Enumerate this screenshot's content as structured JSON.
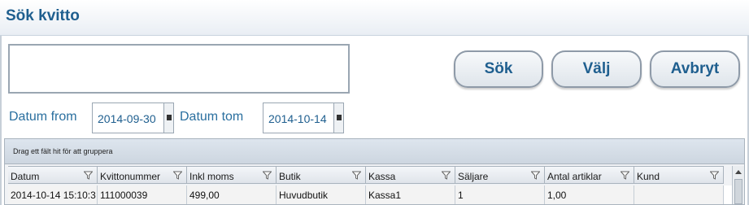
{
  "window": {
    "title": "Sök kvitto"
  },
  "buttons": {
    "search": "Sök",
    "select": "Välj",
    "cancel": "Avbryt"
  },
  "search": {
    "value": ""
  },
  "date_from": {
    "label": "Datum from",
    "value": "2014-09-30"
  },
  "date_to": {
    "label": "Datum tom",
    "value": "2014-10-14"
  },
  "grid": {
    "group_hint": "Drag ett fält hit för att gruppera",
    "columns": [
      "Datum",
      "Kvittonummer",
      "Inkl moms",
      "Butik",
      "Kassa",
      "Säljare",
      "Antal artiklar",
      "Kund"
    ],
    "rows": [
      [
        "2014-10-14 15:10:3",
        "111000039",
        "499,00",
        "Huvudbutik",
        "Kassa1",
        "1",
        "1,00",
        ""
      ]
    ]
  },
  "icons": {
    "filter": "filter-icon",
    "date_picker": "calendar-icon",
    "scroll_up": "arrow-up-icon"
  }
}
